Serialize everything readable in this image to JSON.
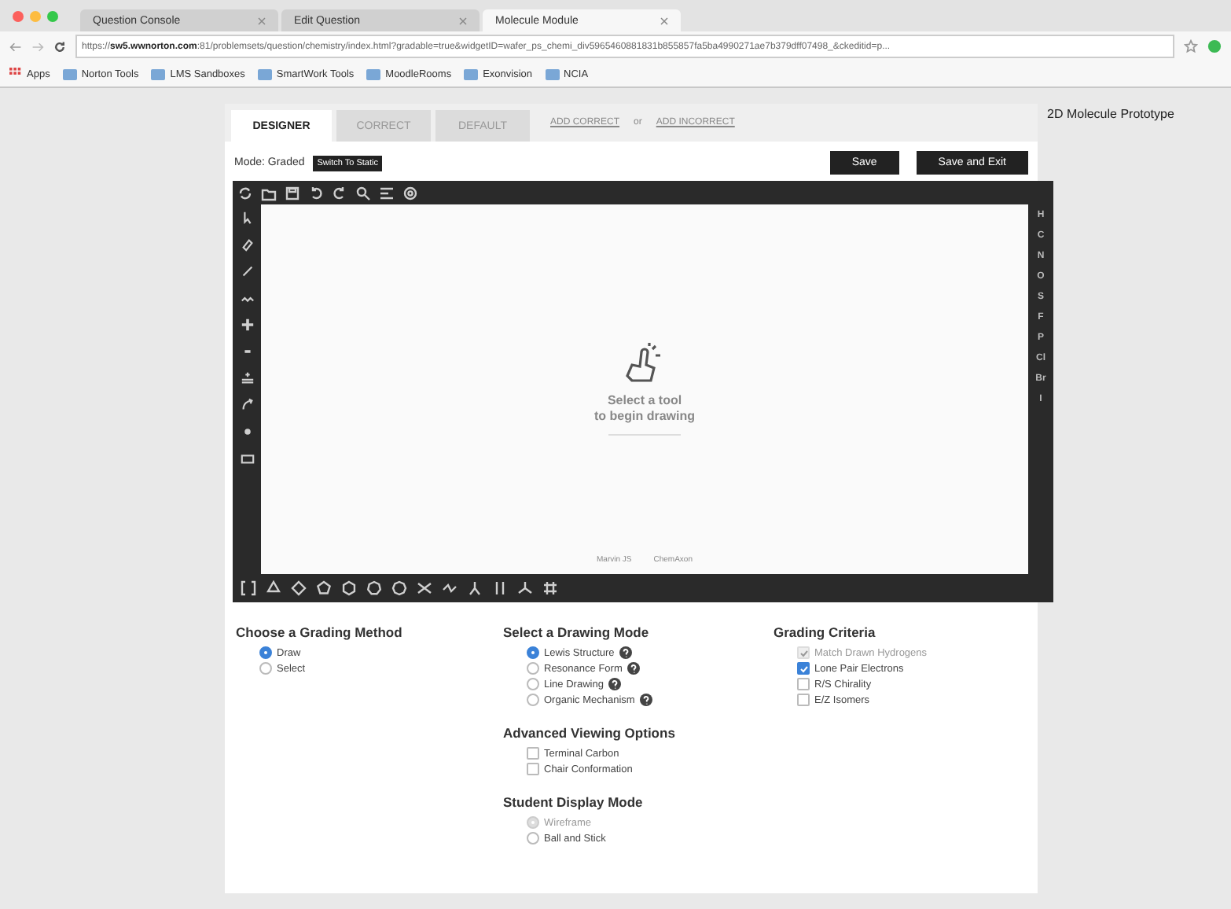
{
  "browser": {
    "tabs": [
      {
        "label": "Question Console",
        "selected": false
      },
      {
        "label": "Edit Question",
        "selected": false
      },
      {
        "label": "Molecule Module",
        "selected": true
      }
    ],
    "address": "https://**sw5.wwnorton.com**:81/problemsets/question/chemistry/index.html?gradable=true&widgetID=wafer_ps_chemi_div5965460881831b855857fa5ba4990271ae7b379dff07498_&ckeditid=p...",
    "bookmarks": [
      "Apps",
      "Norton Tools",
      "LMS Sandboxes",
      "SmartWork Tools",
      "MoodleRooms",
      "Exonvision",
      "NCIA"
    ]
  },
  "page_title": "2D Molecule Prototype",
  "tabs": [
    {
      "label": "DESIGNER",
      "selected": true
    },
    {
      "label": "CORRECT",
      "selected": false
    },
    {
      "label": "DEFAULT",
      "selected": false
    }
  ],
  "add_links": {
    "correct": "ADD CORRECT",
    "separator": "or",
    "incorrect": "ADD INCORRECT"
  },
  "mode": {
    "label": "Mode: Graded",
    "button": "Switch To Static"
  },
  "buttons": [
    "Save",
    "Save and Exit"
  ],
  "editor": {
    "hint": [
      "Select a tool",
      "to begin drawing"
    ],
    "footer": [
      "Marvin JS",
      "ChemAxon"
    ],
    "elements": [
      "H",
      "C",
      "N",
      "O",
      "S",
      "F",
      "P",
      "Cl",
      "Br",
      "I"
    ]
  },
  "option_columns": [
    {
      "sections": [
        {
          "title": "Choose a Grading Method",
          "options": [
            {
              "kind": "radio",
              "label": "Draw",
              "selected": true,
              "disabled": false,
              "help": false
            },
            {
              "kind": "radio",
              "label": "Select",
              "selected": false,
              "disabled": false,
              "help": false
            }
          ]
        }
      ]
    },
    {
      "sections": [
        {
          "title": "Select a Drawing Mode",
          "options": [
            {
              "kind": "radio",
              "label": "Lewis Structure",
              "selected": true,
              "disabled": false,
              "help": true
            },
            {
              "kind": "radio",
              "label": "Resonance Form",
              "selected": false,
              "disabled": false,
              "help": true
            },
            {
              "kind": "radio",
              "label": "Line Drawing",
              "selected": false,
              "disabled": false,
              "help": true
            },
            {
              "kind": "radio",
              "label": "Organic Mechanism",
              "selected": false,
              "disabled": false,
              "help": true
            }
          ]
        },
        {
          "title": "Advanced Viewing Options",
          "options": [
            {
              "kind": "checkbox",
              "label": "Terminal Carbon",
              "checked": false,
              "disabled": false,
              "help": false
            },
            {
              "kind": "checkbox",
              "label": "Chair Conformation",
              "checked": false,
              "disabled": false,
              "help": false
            }
          ]
        },
        {
          "title": "Student Display Mode",
          "options": [
            {
              "kind": "radio",
              "label": "Wireframe",
              "selected": true,
              "disabled": true,
              "help": false
            },
            {
              "kind": "radio",
              "label": "Ball and Stick",
              "selected": false,
              "disabled": false,
              "help": false
            }
          ]
        }
      ]
    },
    {
      "sections": [
        {
          "title": "Grading Criteria",
          "options": [
            {
              "kind": "checkbox",
              "label": "Match Drawn Hydrogens",
              "checked": true,
              "disabled": true,
              "help": false
            },
            {
              "kind": "checkbox",
              "label": "Lone Pair Electrons",
              "checked": true,
              "disabled": false,
              "help": false
            },
            {
              "kind": "checkbox",
              "label": "R/S Chirality",
              "checked": false,
              "disabled": false,
              "help": false
            },
            {
              "kind": "checkbox",
              "label": "E/Z Isomers",
              "checked": false,
              "disabled": false,
              "help": false
            }
          ]
        }
      ]
    }
  ]
}
